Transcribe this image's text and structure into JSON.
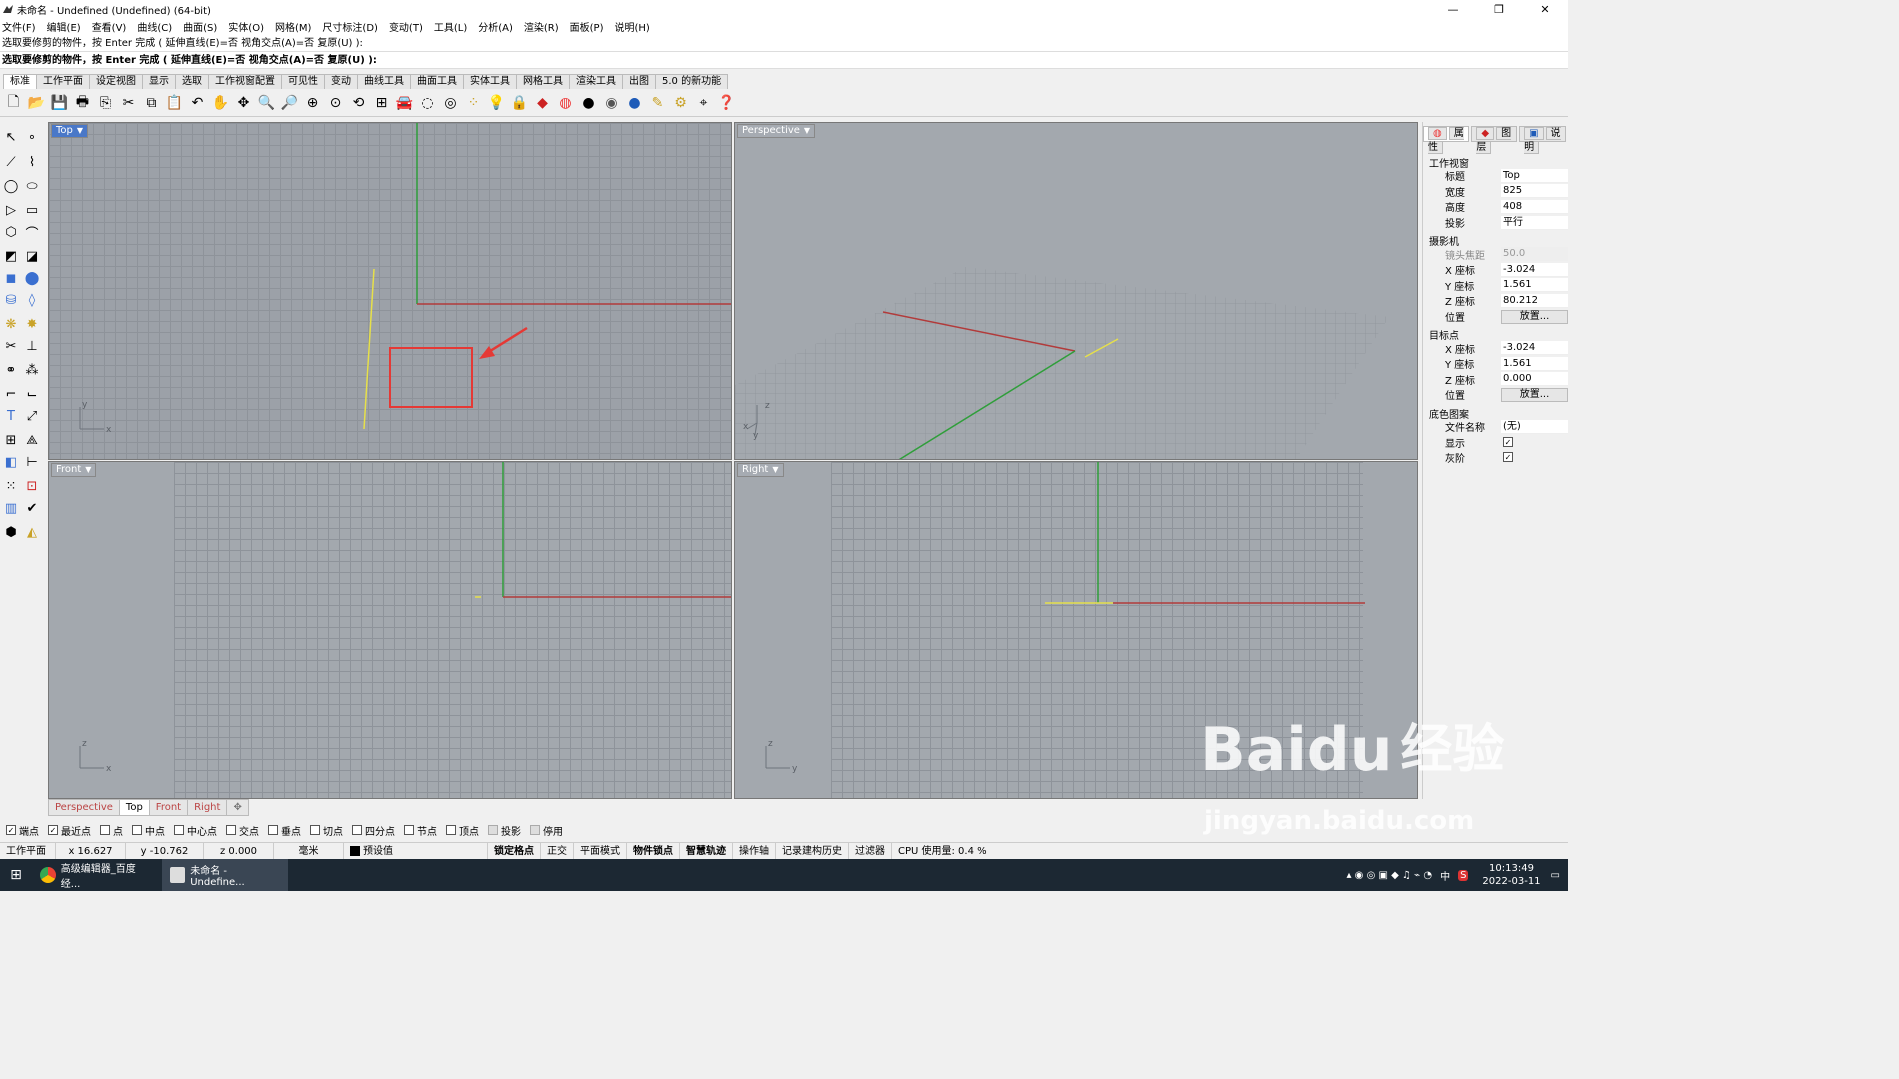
{
  "window": {
    "title": "未命名 - Undefined (Undefined) (64-bit)"
  },
  "menu": [
    "文件(F)",
    "编辑(E)",
    "查看(V)",
    "曲线(C)",
    "曲面(S)",
    "实体(O)",
    "网格(M)",
    "尺寸标注(D)",
    "变动(T)",
    "工具(L)",
    "分析(A)",
    "渲染(R)",
    "面板(P)",
    "说明(H)"
  ],
  "command": {
    "history": "选取要修剪的物件，按 Enter 完成 ( 延伸直线(E)=否  视角交点(A)=否  复原(U) ):",
    "prompt": "选取要修剪的物件，按 Enter 完成 ( 延伸直线(E)=否  视角交点(A)=否  复原(U) ):"
  },
  "toolbar_tabs": [
    "标准",
    "工作平面",
    "设定视图",
    "显示",
    "选取",
    "工作视窗配置",
    "可见性",
    "变动",
    "曲线工具",
    "曲面工具",
    "实体工具",
    "网格工具",
    "渲染工具",
    "出图",
    "5.0 的新功能"
  ],
  "toolbar_icons": [
    "new-icon",
    "open-icon",
    "save-icon",
    "print-icon",
    "import-icon",
    "cut-icon",
    "copy-icon",
    "paste-icon",
    "undo-icon",
    "pan-icon",
    "rotate-view-icon",
    "zoom-icon",
    "zoom-window-icon",
    "zoom-extents-icon",
    "zoom-selected-icon",
    "undo-view-icon",
    "viewport-layout-icon",
    "car-icon",
    "hide-icon",
    "show-icon",
    "points-icon",
    "light-icon",
    "lock-icon",
    "layer-color-icon",
    "color-wheel-icon",
    "material-icon",
    "render-icon",
    "render-blue-icon",
    "paint-icon",
    "options-icon",
    "gumball-icon",
    "help-icon"
  ],
  "viewports": {
    "top": {
      "label": "Top"
    },
    "perspective": {
      "label": "Perspective"
    },
    "front": {
      "label": "Front"
    },
    "right": {
      "label": "Right"
    }
  },
  "axes": {
    "top": {
      "x": "x",
      "y": "y"
    },
    "perspective": {
      "x": "x",
      "y": "y",
      "z": "z"
    },
    "front": {
      "x": "x",
      "z": "z"
    },
    "right": {
      "y": "y",
      "z": "z"
    }
  },
  "viewport_tabs": [
    "Perspective",
    "Top",
    "Front",
    "Right"
  ],
  "panel": {
    "tabs": [
      "属性",
      "图层",
      "说明"
    ],
    "section_viewport": "工作视窗",
    "title_k": "标题",
    "title_v": "Top",
    "width_k": "宽度",
    "width_v": "825",
    "height_k": "高度",
    "height_v": "408",
    "proj_k": "投影",
    "proj_v": "平行",
    "section_camera": "摄影机",
    "lens_k": "镜头焦距",
    "lens_v": "50.0",
    "cx_k": "X 座标",
    "cx_v": "-3.024",
    "cy_k": "Y 座标",
    "cy_v": "1.561",
    "cz_k": "Z 座标",
    "cz_v": "80.212",
    "pos_k": "位置",
    "pos_btn": "放置...",
    "section_target": "目标点",
    "tx_k": "X 座标",
    "tx_v": "-3.024",
    "ty_k": "Y 座标",
    "ty_v": "1.561",
    "tz_k": "Z 座标",
    "tz_v": "0.000",
    "tpos_k": "位置",
    "tpos_btn": "放置...",
    "section_wallpaper": "底色图案",
    "file_k": "文件名称",
    "file_v": "(无)",
    "show_k": "显示",
    "gray_k": "灰阶"
  },
  "osnap": [
    {
      "label": "端点",
      "checked": true
    },
    {
      "label": "最近点",
      "checked": true
    },
    {
      "label": "点",
      "checked": false
    },
    {
      "label": "中点",
      "checked": false
    },
    {
      "label": "中心点",
      "checked": false
    },
    {
      "label": "交点",
      "checked": false
    },
    {
      "label": "垂点",
      "checked": false
    },
    {
      "label": "切点",
      "checked": false
    },
    {
      "label": "四分点",
      "checked": false
    },
    {
      "label": "节点",
      "checked": false
    },
    {
      "label": "顶点",
      "checked": false
    },
    {
      "label": "投影",
      "checked": false
    },
    {
      "label": "停用",
      "checked": false
    }
  ],
  "status": {
    "cplane": "工作平面",
    "x": "x 16.627",
    "y": "y -10.762",
    "z": "z 0.000",
    "unit": "毫米",
    "layer": "预设值",
    "grid_snap": "锁定格点",
    "ortho": "正交",
    "planar": "平面模式",
    "osnap": "物件锁点",
    "smarttrack": "智慧轨迹",
    "gumball": "操作轴",
    "history": "记录建构历史",
    "filter": "过滤器",
    "cpu": "CPU 使用量: 0.4 %"
  },
  "taskbar": {
    "task1": "高级编辑器_百度经...",
    "task2": "未命名 - Undefine...",
    "time": "10:13:49",
    "date": "2022-03-11",
    "ime": "中"
  },
  "watermark": {
    "brand": "Bai",
    "paw": "du",
    "product": "经验",
    "url": "jingyan.baidu.com"
  },
  "colors": {
    "x_axis": "#b23a3a",
    "y_axis": "#2f9e3a",
    "curve": "#e6e04a",
    "highlight": "#e53935",
    "viewport_bg": "#9ca1a8",
    "active_label": "#4a78c8"
  }
}
